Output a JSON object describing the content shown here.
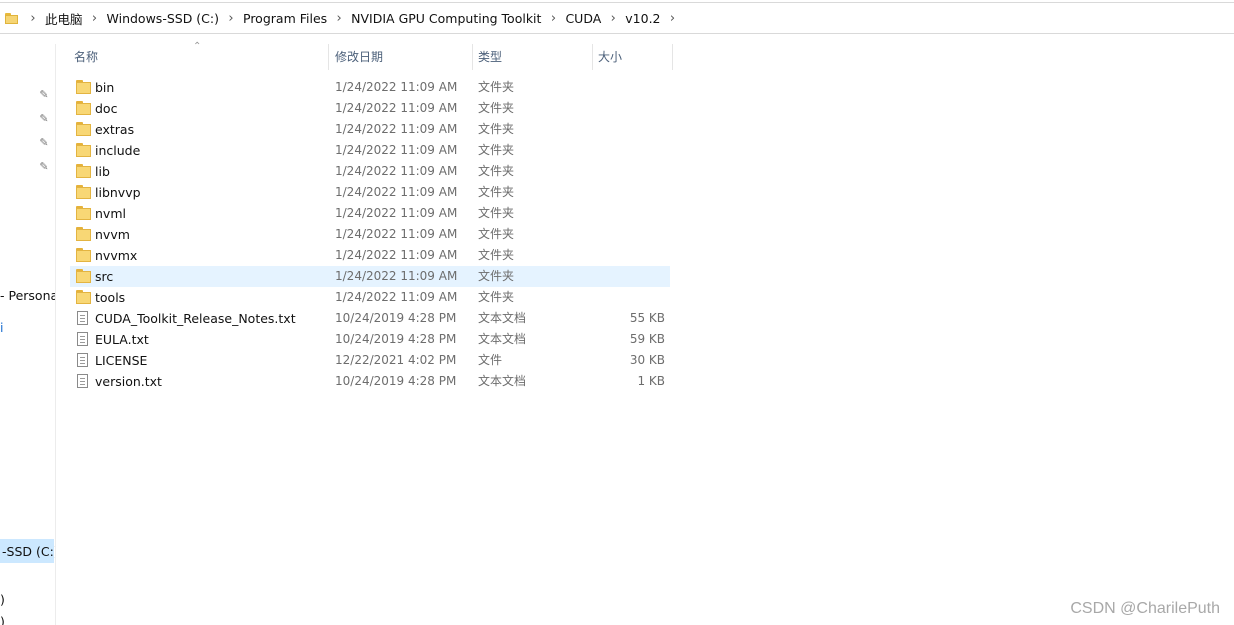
{
  "breadcrumb": [
    "此电脑",
    "Windows-SSD (C:)",
    "Program Files",
    "NVIDIA GPU Computing Toolkit",
    "CUDA",
    "v10.2"
  ],
  "columns": {
    "name": "名称",
    "date": "修改日期",
    "type": "类型",
    "size": "大小"
  },
  "nav": {
    "persona": "- Persona",
    "i": "i",
    "drive": "-SSD (C:)",
    "p1": ")",
    "p2": ")"
  },
  "files": [
    {
      "name": "bin",
      "date": "1/24/2022 11:09 AM",
      "type": "文件夹",
      "size": "",
      "kind": "folder"
    },
    {
      "name": "doc",
      "date": "1/24/2022 11:09 AM",
      "type": "文件夹",
      "size": "",
      "kind": "folder"
    },
    {
      "name": "extras",
      "date": "1/24/2022 11:09 AM",
      "type": "文件夹",
      "size": "",
      "kind": "folder"
    },
    {
      "name": "include",
      "date": "1/24/2022 11:09 AM",
      "type": "文件夹",
      "size": "",
      "kind": "folder"
    },
    {
      "name": "lib",
      "date": "1/24/2022 11:09 AM",
      "type": "文件夹",
      "size": "",
      "kind": "folder"
    },
    {
      "name": "libnvvp",
      "date": "1/24/2022 11:09 AM",
      "type": "文件夹",
      "size": "",
      "kind": "folder"
    },
    {
      "name": "nvml",
      "date": "1/24/2022 11:09 AM",
      "type": "文件夹",
      "size": "",
      "kind": "folder"
    },
    {
      "name": "nvvm",
      "date": "1/24/2022 11:09 AM",
      "type": "文件夹",
      "size": "",
      "kind": "folder"
    },
    {
      "name": "nvvmx",
      "date": "1/24/2022 11:09 AM",
      "type": "文件夹",
      "size": "",
      "kind": "folder"
    },
    {
      "name": "src",
      "date": "1/24/2022 11:09 AM",
      "type": "文件夹",
      "size": "",
      "kind": "folder"
    },
    {
      "name": "tools",
      "date": "1/24/2022 11:09 AM",
      "type": "文件夹",
      "size": "",
      "kind": "folder"
    },
    {
      "name": "CUDA_Toolkit_Release_Notes.txt",
      "date": "10/24/2019 4:28 PM",
      "type": "文本文档",
      "size": "55 KB",
      "kind": "file"
    },
    {
      "name": "EULA.txt",
      "date": "10/24/2019 4:28 PM",
      "type": "文本文档",
      "size": "59 KB",
      "kind": "file"
    },
    {
      "name": "LICENSE",
      "date": "12/22/2021 4:02 PM",
      "type": "文件",
      "size": "30 KB",
      "kind": "file"
    },
    {
      "name": "version.txt",
      "date": "10/24/2019 4:28 PM",
      "type": "文本文档",
      "size": "1 KB",
      "kind": "file"
    }
  ],
  "selected_file": "src",
  "watermark": "CSDN @CharilePuth",
  "colors": {
    "selection": "#e5f3ff",
    "nav_selected": "#cce8ff",
    "folder": "#f8d775"
  }
}
